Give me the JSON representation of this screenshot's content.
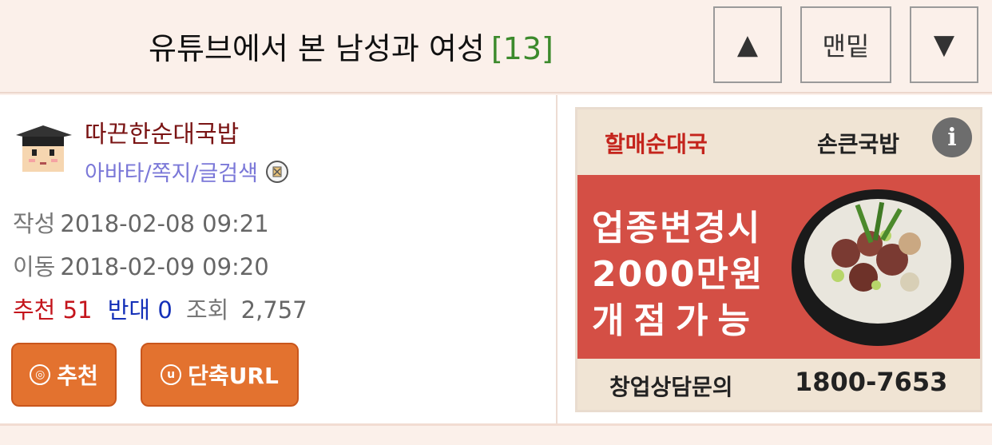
{
  "header": {
    "title": "유튜브에서 본 남성과 여성",
    "comment_count": "[13]",
    "up_label": "▲",
    "bottom_label": "맨밑",
    "down_label": "▼"
  },
  "post": {
    "author": "따끈한순대국밥",
    "author_links": "아바타/쪽지/글검색",
    "written_label": "작성",
    "written_value": "2018-02-08 09:21",
    "moved_label": "이동",
    "moved_value": "2018-02-09 09:20",
    "recommend_label": "추천",
    "recommend_value": "51",
    "oppose_label": "반대",
    "oppose_value": "0",
    "views_label": "조회",
    "views_value": "2,757",
    "recommend_button": "추천",
    "shorturl_button": "단축URL"
  },
  "ad": {
    "brand1": "할매순대국",
    "brand2": "손큰국밥",
    "info_icon": "i",
    "line1": "업종변경시",
    "line2": "2000만원",
    "line3": "개점가능",
    "cta": "창업상담문의",
    "phone": "1800-7653"
  },
  "colors": {
    "recommend": "#c4151c",
    "oppose": "#1430b8",
    "button": "#e3722f",
    "ad_bg": "#d44f45"
  }
}
